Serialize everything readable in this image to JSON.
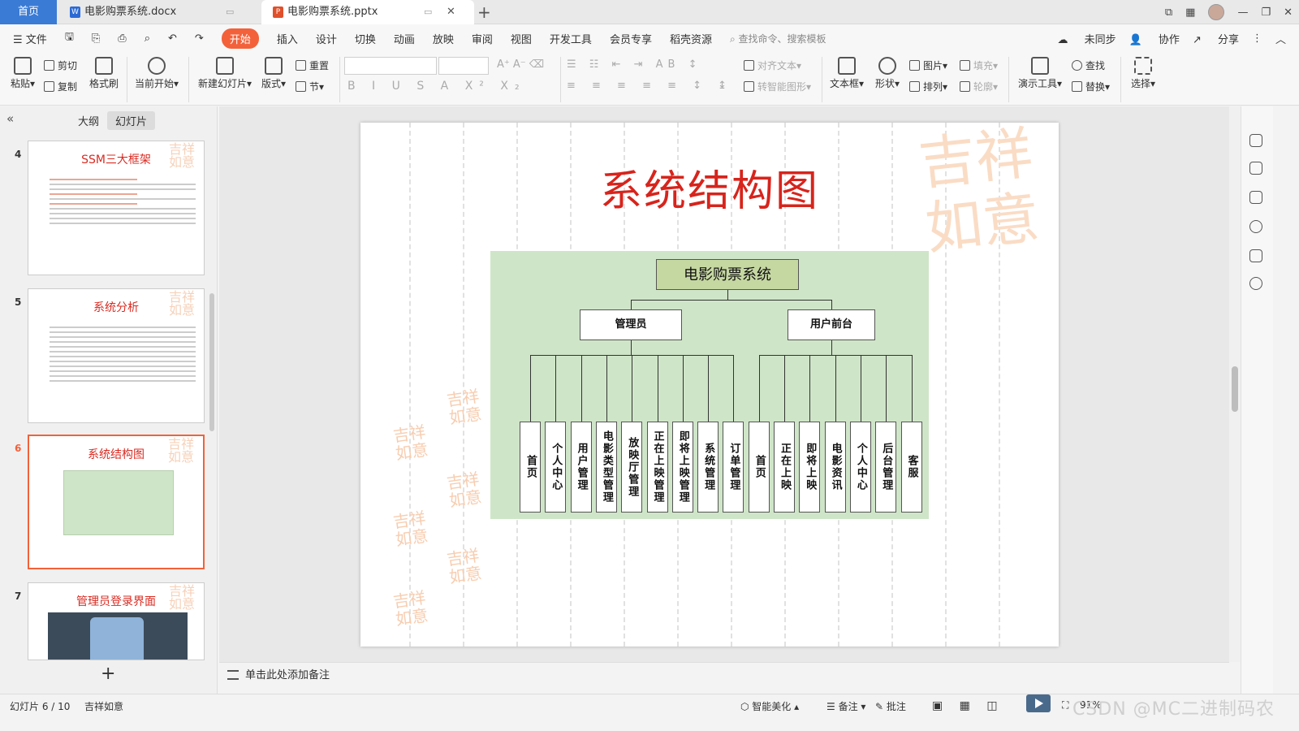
{
  "tabs": {
    "home": "首页",
    "doc": "电影购票系统.docx",
    "ppt": "电影购票系统.pptx"
  },
  "menu": {
    "file": "文件",
    "items": [
      "开始",
      "插入",
      "设计",
      "切换",
      "动画",
      "放映",
      "审阅",
      "视图",
      "开发工具",
      "会员专享",
      "稻壳资源"
    ],
    "search": "查找命令、搜索模板",
    "right": [
      "未同步",
      "协作",
      "分享"
    ]
  },
  "ribbon": {
    "paste": "粘贴",
    "cut": "剪切",
    "copy": "复制",
    "format_painter": "格式刷",
    "from_current": "当前开始",
    "new_slide": "新建幻灯片",
    "layout": "版式",
    "reset": "重置",
    "section": "节",
    "align_text": "对齐文本",
    "smartart": "转智能图形",
    "textbox": "文本框",
    "shape": "形状",
    "picture": "图片",
    "arrange": "排列",
    "fill": "填充",
    "outline": "轮廓",
    "tools": "演示工具",
    "find": "查找",
    "replace": "替换",
    "select": "选择"
  },
  "panel": {
    "outline_tab": "大纲",
    "slides_tab": "幻灯片",
    "thumbs": [
      {
        "num": "4",
        "title": "SSM三大框架"
      },
      {
        "num": "5",
        "title": "系统分析"
      },
      {
        "num": "6",
        "title": "系统结构图"
      },
      {
        "num": "7",
        "title": "管理员登录界面"
      }
    ]
  },
  "slide": {
    "title": "系统结构图",
    "seal_text": "吉祥如意",
    "root": "电影购票系统",
    "admin": "管理员",
    "front": "用户前台",
    "admin_leaves": [
      "首页",
      "个人中心",
      "用户管理",
      "电影类型管理",
      "放映厅管理",
      "正在上映管理",
      "即将上映管理",
      "系统管理",
      "订单管理"
    ],
    "front_leaves": [
      "首页",
      "正在上映",
      "即将上映",
      "电影资讯",
      "个人中心",
      "后台管理",
      "客服"
    ]
  },
  "notes_placeholder": "单击此处添加备注",
  "status": {
    "slide_count": "幻灯片 6 / 10",
    "theme": "吉祥如意",
    "beautify": "智能美化",
    "notes": "备注",
    "comments": "批注",
    "zoom": "91%",
    "watermark": "CSDN @MC二进制码农"
  }
}
